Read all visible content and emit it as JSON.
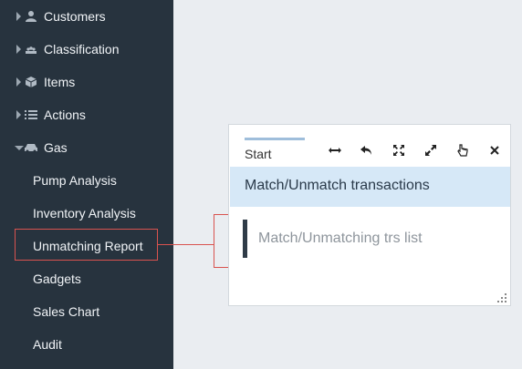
{
  "sidebar": {
    "items": [
      {
        "label": "Customers",
        "icon": "user-icon"
      },
      {
        "label": "Classification",
        "icon": "users-icon"
      },
      {
        "label": "Items",
        "icon": "cube-icon"
      },
      {
        "label": "Actions",
        "icon": "list-icon"
      },
      {
        "label": "Gas",
        "icon": "car-icon",
        "expanded": true
      }
    ],
    "sub_items": [
      {
        "label": "Pump Analysis"
      },
      {
        "label": "Inventory Analysis"
      },
      {
        "label": "Unmatching Report",
        "highlighted": true
      },
      {
        "label": "Gadgets"
      },
      {
        "label": "Sales Chart"
      },
      {
        "label": "Audit"
      }
    ]
  },
  "widget": {
    "tab_label": "Start",
    "title": "Match/Unmatch transactions",
    "list_item": "Match/Unmatching trs list",
    "toolbar_icons": [
      "resize-horizontal-icon",
      "undo-icon",
      "expand-icon",
      "fullscreen-icon",
      "pointer-icon",
      "close-icon"
    ]
  },
  "colors": {
    "sidebar_bg": "#27333e",
    "page_bg": "#eaedf1",
    "highlight": "#d9534f",
    "title_band": "#d6e8f7",
    "tab_underline": "#9fbedb"
  }
}
